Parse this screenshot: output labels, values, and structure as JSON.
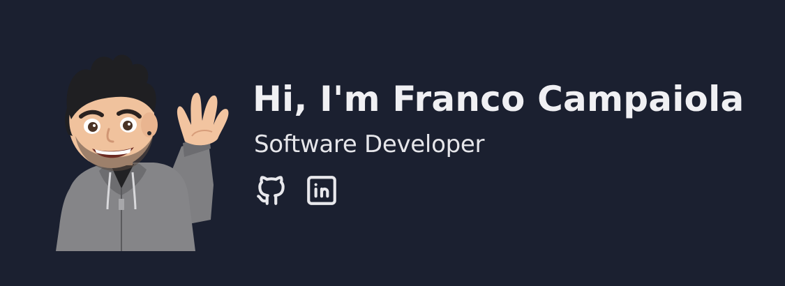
{
  "hero": {
    "name": "Hi, I'm Franco Campaiola",
    "role": "Software Developer",
    "avatar_icon": "waving-memoji-avatar",
    "social_links": [
      {
        "icon": "github-icon"
      },
      {
        "icon": "linkedin-icon"
      }
    ]
  },
  "colors": {
    "background": "#1b2030",
    "heading_text": "#f0f0f3",
    "subtitle_text": "#e6e6ea",
    "icon_stroke": "#e8e8ec"
  }
}
